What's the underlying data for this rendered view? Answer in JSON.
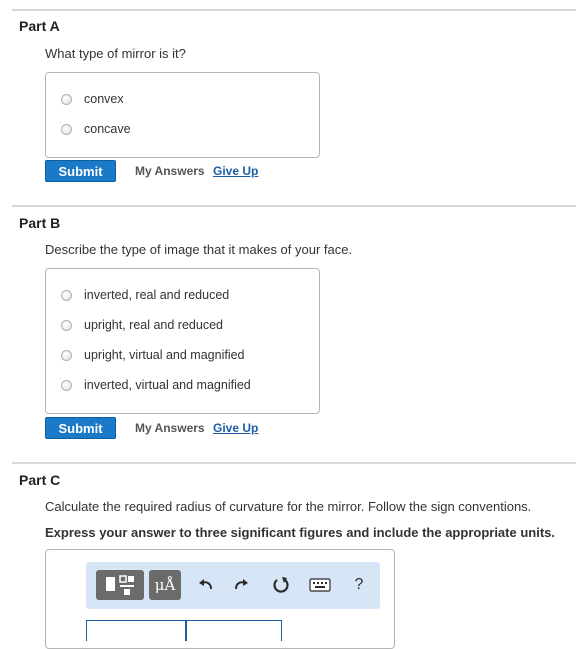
{
  "parts": [
    {
      "title": "Part A",
      "question": "What type of mirror is it?",
      "options": [
        "convex",
        "concave"
      ],
      "submit_label": "Submit",
      "my_answers_label": "My Answers",
      "give_up_label": "Give Up"
    },
    {
      "title": "Part B",
      "question": "Describe the type of image that it makes of your face.",
      "options": [
        "inverted, real and reduced",
        "upright, real and reduced",
        "upright, virtual and magnified",
        "inverted, virtual and magnified"
      ],
      "submit_label": "Submit",
      "my_answers_label": "My Answers",
      "give_up_label": "Give Up"
    },
    {
      "title": "Part C",
      "question": "Calculate the required radius of curvature for the mirror. Follow the sign conventions.",
      "instruction": "Express your answer to three significant figures and include the appropriate units."
    }
  ],
  "toolbar": {
    "icons": [
      "templates-icon",
      "units-icon",
      "undo-icon",
      "redo-icon",
      "reset-icon",
      "keyboard-icon",
      "help-icon"
    ],
    "units_glyph": "μÅ",
    "help_glyph": "?",
    "accent": "#d6e6f7"
  },
  "colors": {
    "submit": "#1a7ac7",
    "link": "#1a5fa6"
  }
}
